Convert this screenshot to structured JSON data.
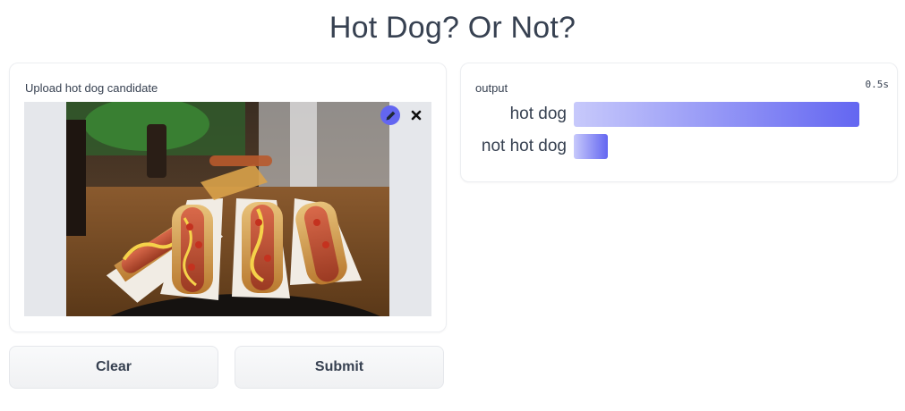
{
  "title": "Hot Dog? Or Not?",
  "input": {
    "label": "Upload hot dog candidate",
    "image_icon_names": [
      "edit-icon",
      "close-icon"
    ]
  },
  "output": {
    "label": "output",
    "elapsed": "0.5s",
    "results": [
      {
        "label": "hot dog",
        "confidence": 1.0
      },
      {
        "label": "not hot dog",
        "confidence": 0.1
      }
    ]
  },
  "buttons": {
    "clear": "Clear",
    "submit": "Submit"
  },
  "colors": {
    "accent": "#6366f1",
    "bar_start": "#c7c9fb",
    "text": "#374151"
  }
}
